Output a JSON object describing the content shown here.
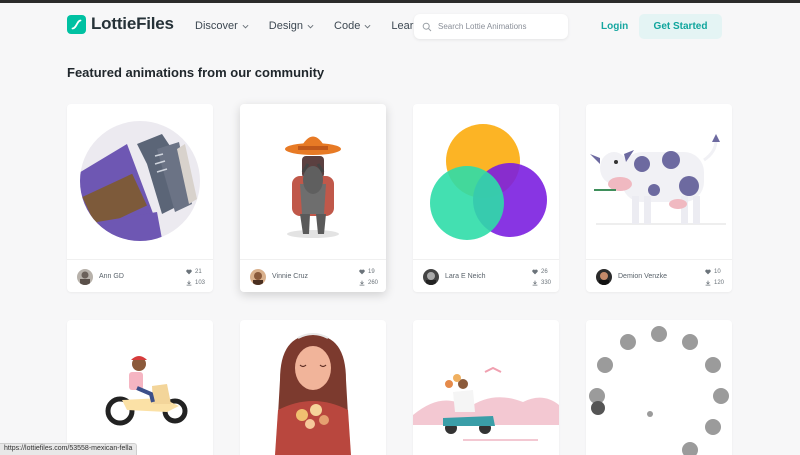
{
  "brand": {
    "name": "LottieFiles"
  },
  "nav": {
    "items": [
      {
        "label": "Discover"
      },
      {
        "label": "Design"
      },
      {
        "label": "Code"
      },
      {
        "label": "Learn"
      }
    ]
  },
  "search": {
    "placeholder": "Search Lottie Animations"
  },
  "auth": {
    "login_label": "Login",
    "get_started_label": "Get Started"
  },
  "section": {
    "title": "Featured animations from our community"
  },
  "cards": [
    {
      "author": "Ann GD",
      "likes": "21",
      "downloads": "103"
    },
    {
      "author": "Vinnie Cruz",
      "likes": "19",
      "downloads": "260"
    },
    {
      "author": "Lara E Neich",
      "likes": "26",
      "downloads": "330"
    },
    {
      "author": "Demion Venzke",
      "likes": "10",
      "downloads": "120"
    }
  ],
  "status_bar": {
    "url": "https://lottiefiles.com/53558-mexican-fella"
  },
  "colors": {
    "accent": "#00c1a2",
    "login": "#16a6a0",
    "get_started_bg": "#e4f4f4"
  }
}
